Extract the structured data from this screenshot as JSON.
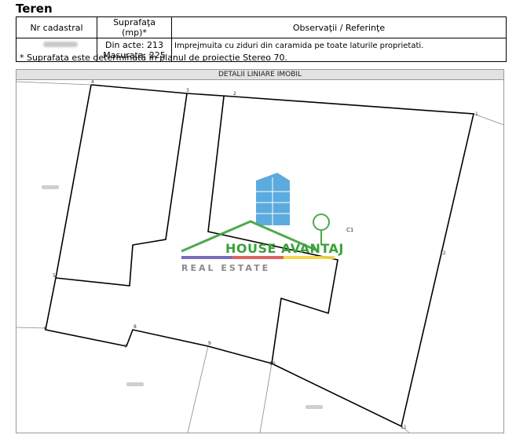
{
  "section_title": "Teren",
  "table": {
    "headers": {
      "nr_cadastral": "Nr cadastral",
      "suprafata": "Suprafaţa (mp)*",
      "observatii": "Observaţii / Referinţe"
    },
    "row": {
      "din_acte": "Din acte: 213",
      "masurata": "Masurata: 225",
      "observatii": "Imprejmuita cu ziduri din caramida pe toate laturile proprietati."
    }
  },
  "footnote": "* Suprafaţa este determinată în planul de proiecţie Stereo 70.",
  "panel": {
    "header": "DETALII LINIARE IMOBIL"
  },
  "plan": {
    "points": [
      "1",
      "2",
      "3",
      "4",
      "5",
      "6",
      "7",
      "8",
      "9",
      "10",
      "11",
      "12"
    ],
    "building_label": "C1",
    "line_color": "#000000",
    "neighbor_line_color": "#8a8a8a"
  },
  "logo": {
    "name": "HOUSE AVANTAJ",
    "tagline": "REAL ESTATE",
    "colors": {
      "green": "#3aa13a",
      "blue": "#4aa3dc",
      "gray": "#8a8a8a",
      "purple": "#6b5bb5",
      "red": "#d9534f",
      "yellow": "#f2d43a"
    }
  }
}
